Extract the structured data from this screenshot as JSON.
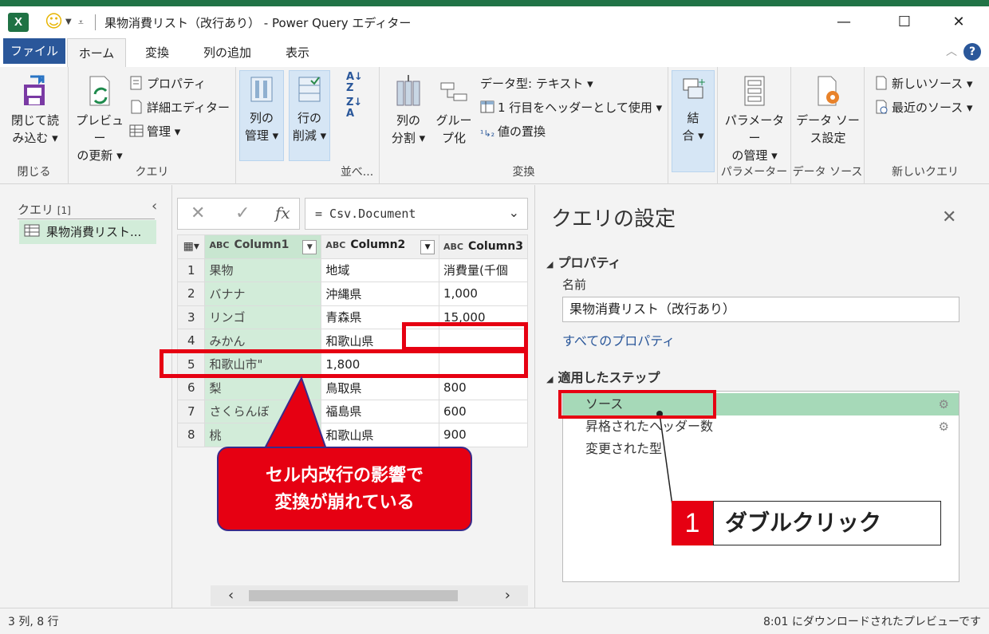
{
  "window": {
    "title": "果物消費リスト（改行あり） - Power Query エディター",
    "excel_icon": "X",
    "minimize": "—",
    "maximize": "☐",
    "close": "✕"
  },
  "menu": {
    "tabs": [
      "ファイル",
      "ホーム",
      "変換",
      "列の追加",
      "表示"
    ],
    "help": "?"
  },
  "ribbon": {
    "close": {
      "line1": "閉じて読",
      "line2": "み込む ▾",
      "group": "閉じる"
    },
    "query": {
      "refresh_line1": "プレビュー",
      "refresh_line2": "の更新 ▾",
      "properties": "プロパティ",
      "advanced_editor": "詳細エディター",
      "manage": "管理 ▾",
      "group": "クエリ"
    },
    "columns": {
      "manage_line1": "列の",
      "manage_line2": "管理 ▾",
      "reduce_line1": "行の",
      "reduce_line2": "削減 ▾"
    },
    "sort": {
      "group": "並べ..."
    },
    "transform": {
      "split_line1": "列の",
      "split_line2": "分割 ▾",
      "group_line1": "グルー",
      "group_line2": "プ化",
      "datatype": "データ型: テキスト ▾",
      "use_header": "1 行目をヘッダーとして使用 ▾",
      "replace": "値の置換",
      "group": "変換"
    },
    "combine": {
      "line1": "結",
      "line2": "合 ▾"
    },
    "params": {
      "line1": "パラメーター",
      "line2": "の管理 ▾",
      "group": "パラメーター"
    },
    "datasource": {
      "line1": "データ ソー",
      "line2": "ス設定",
      "group": "データ ソース"
    },
    "newquery": {
      "new_source": "新しいソース ▾",
      "recent_source": "最近のソース ▾",
      "group": "新しいクエリ"
    }
  },
  "queries_panel": {
    "header": "クエリ",
    "count": "[1]",
    "items": [
      "果物消費リスト..."
    ]
  },
  "formula_bar": {
    "formula": "= Csv.Document",
    "fx": "fx"
  },
  "grid": {
    "type_label": "ABC",
    "headers": [
      "Column1",
      "Column2",
      "Column3"
    ],
    "rows": [
      {
        "n": "1",
        "c1": "果物",
        "c2": "地域",
        "c3": "消費量(千個"
      },
      {
        "n": "2",
        "c1": "バナナ",
        "c2": "沖縄県",
        "c3": "1,000"
      },
      {
        "n": "3",
        "c1": "リンゴ",
        "c2": "青森県",
        "c3": "15,000"
      },
      {
        "n": "4",
        "c1": "みかん",
        "c2": "和歌山県",
        "c3": ""
      },
      {
        "n": "5",
        "c1": "和歌山市\"",
        "c2": "1,800",
        "c3": ""
      },
      {
        "n": "6",
        "c1": "梨",
        "c2": "鳥取県",
        "c3": "800"
      },
      {
        "n": "7",
        "c1": "さくらんぼ",
        "c2": "福島県",
        "c3": "600"
      },
      {
        "n": "8",
        "c1": "桃",
        "c2": "和歌山県",
        "c3": "900"
      }
    ]
  },
  "annotation": {
    "callout_line1": "セル内改行の影響で",
    "callout_line2": "変換が崩れている",
    "step_number": "1",
    "step_text": "ダブルクリック"
  },
  "settings": {
    "title": "クエリの設定",
    "properties_header": "プロパティ",
    "name_label": "名前",
    "name_value": "果物消費リスト（改行あり）",
    "all_properties": "すべてのプロパティ",
    "steps_header": "適用したステップ",
    "steps": [
      "ソース",
      "昇格されたヘッダー数",
      "変更された型"
    ]
  },
  "status": {
    "left": "3 列, 8 行",
    "right": "8:01 にダウンロードされたプレビューです"
  },
  "colors": {
    "accent": "#2a579a",
    "excel_green": "#217346",
    "highlight_red": "#e60012",
    "selected_step": "#a6d9b8"
  }
}
